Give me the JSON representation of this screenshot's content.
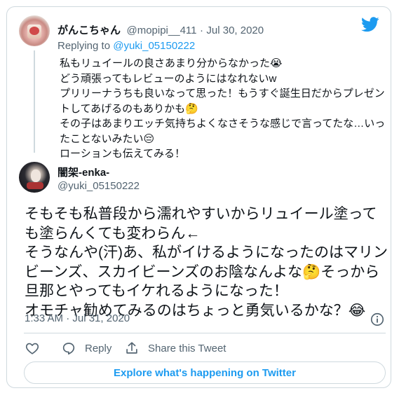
{
  "quoted_tweet": {
    "display_name": "がんこちゃん",
    "handle": "@mopipi__411",
    "separator": "·",
    "date": "Jul 30, 2020",
    "replying_prefix": "Replying to",
    "replying_handle": "@yuki_05150222",
    "text": "私もリュイールの良さあまり分からなかった😭\nどう頑張ってもレビューのようにはなれないw\nプリリーナうちも良いなって思った！もうすぐ誕生日だからプレゼントしてあげるのもありかも🤔\nその子はあまりエッチ気持ちよくなさそうな感じで言ってたな…いったことないみたい😔\nローションも伝えてみる！"
  },
  "main_tweet": {
    "display_name": "闇架-enka-",
    "handle": "@yuki_05150222",
    "text": "そもそも私普段から濡れやすいからリュイール塗っても塗らんくても変わらん←\nそうなんや(汗)あ、私がイけるようになったのはマリンビーンズ、スカイビーンズのお陰なんよな🤔そっから旦那とやってもイケれるようになった！\nオモチャ勧めてみるのはちょっと勇気いるかな？😂",
    "timestamp": "1:33 AM · Jul 31, 2020"
  },
  "actions": {
    "reply_label": "Reply",
    "share_label": "Share this Tweet"
  },
  "explore_label": "Explore what's happening on Twitter",
  "colors": {
    "accent": "#1d9bf0",
    "text": "#0f1419",
    "muted": "#536471",
    "border": "#cfd9de"
  },
  "icons": [
    "twitter-logo-icon",
    "info-icon",
    "heart-icon",
    "reply-icon",
    "share-icon"
  ]
}
